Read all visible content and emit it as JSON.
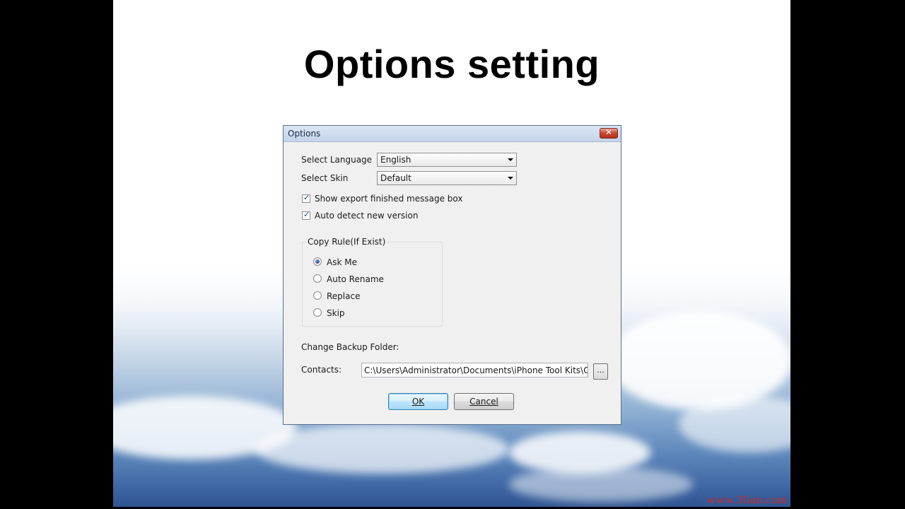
{
  "slide": {
    "title": "Options setting",
    "watermark": "www.3lian.com"
  },
  "dialog": {
    "title": "Options",
    "language_label": "Select Language",
    "language_value": "English",
    "skin_label": "Select Skin",
    "skin_value": "Default",
    "show_export_label": "Show export finished message box",
    "show_export_checked": true,
    "auto_detect_label": "Auto detect new version",
    "auto_detect_checked": true,
    "copy_rule": {
      "label": "Copy Rule(If Exist)",
      "options": [
        "Ask Me",
        "Auto Rename",
        "Replace",
        "Skip"
      ],
      "selected": "Ask Me"
    },
    "backup_folder_label": "Change Backup Folder:",
    "contacts_label": "Contacts:",
    "contacts_path": "C:\\Users\\Administrator\\Documents\\iPhone Tool Kits\\Conta",
    "browse_label": "...",
    "ok_label": "OK",
    "cancel_label": "Cancel"
  },
  "colors": {
    "title_bar": "#c4d5ea",
    "close_button": "#c8462f",
    "default_button_border": "#3c7fb1",
    "watermark": "#dd2222"
  }
}
